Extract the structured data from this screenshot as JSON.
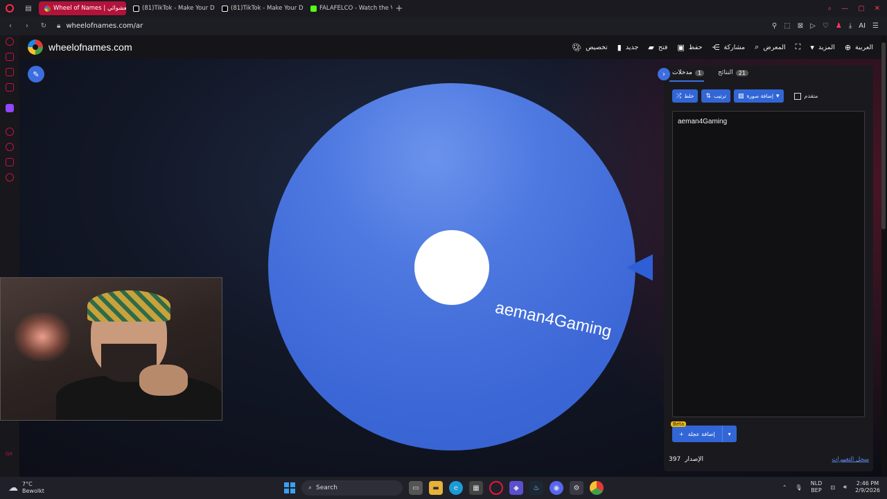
{
  "browser": {
    "tabs": [
      {
        "label": "Wheel of Names | عجلة العشوائي",
        "active": true,
        "color": "#e53935"
      },
      {
        "label": "(81)TikTok - Make Your Da",
        "active": false,
        "color": "#ffffff"
      },
      {
        "label": "(81)TikTok - Make Your Da",
        "active": false,
        "color": "#ffffff"
      },
      {
        "label": "FALAFELCO - Watch the V",
        "active": false,
        "color": "#53fc18"
      }
    ],
    "url": "wheelofnames.com/ar",
    "ai_label": "AI"
  },
  "site": {
    "name": "wheelofnames.com",
    "menu": [
      {
        "label": "تخصيص",
        "icon": "palette-icon"
      },
      {
        "label": "جديد",
        "icon": "file-icon"
      },
      {
        "label": "فتح",
        "icon": "folder-icon"
      },
      {
        "label": "حفظ",
        "icon": "save-icon"
      },
      {
        "label": "مشاركة",
        "icon": "share-icon"
      },
      {
        "label": "المعرض",
        "icon": "search-icon"
      },
      {
        "label": "",
        "icon": "fullscreen-icon"
      },
      {
        "label": "المزيد",
        "icon": "dropdown-icon"
      },
      {
        "label": "العربية",
        "icon": "globe-icon"
      }
    ]
  },
  "wheel": {
    "label": "aeman4Gaming",
    "color": "#3c67d6"
  },
  "panel": {
    "entries_tab": "مدخلات",
    "entries_count": "1",
    "results_tab": "النتائج",
    "results_count": "21",
    "shuffle": "خلط",
    "sort": "ترتيب",
    "add_image": "إضافة صورة",
    "advanced": "متقدم",
    "entries_text": "aeman4Gaming",
    "add_wheel": "إضافة عجلة",
    "beta": "Beta",
    "version_label": "الإصدار",
    "version_number": "397",
    "changelog": "سجل التغييرات"
  },
  "taskbar": {
    "temp": "7°C",
    "weather": "Bewolkt",
    "search": "Search",
    "lang_line1": "NLD",
    "lang_line2": "BEP",
    "time": "2:46 PM",
    "date": "2/9/2026"
  }
}
